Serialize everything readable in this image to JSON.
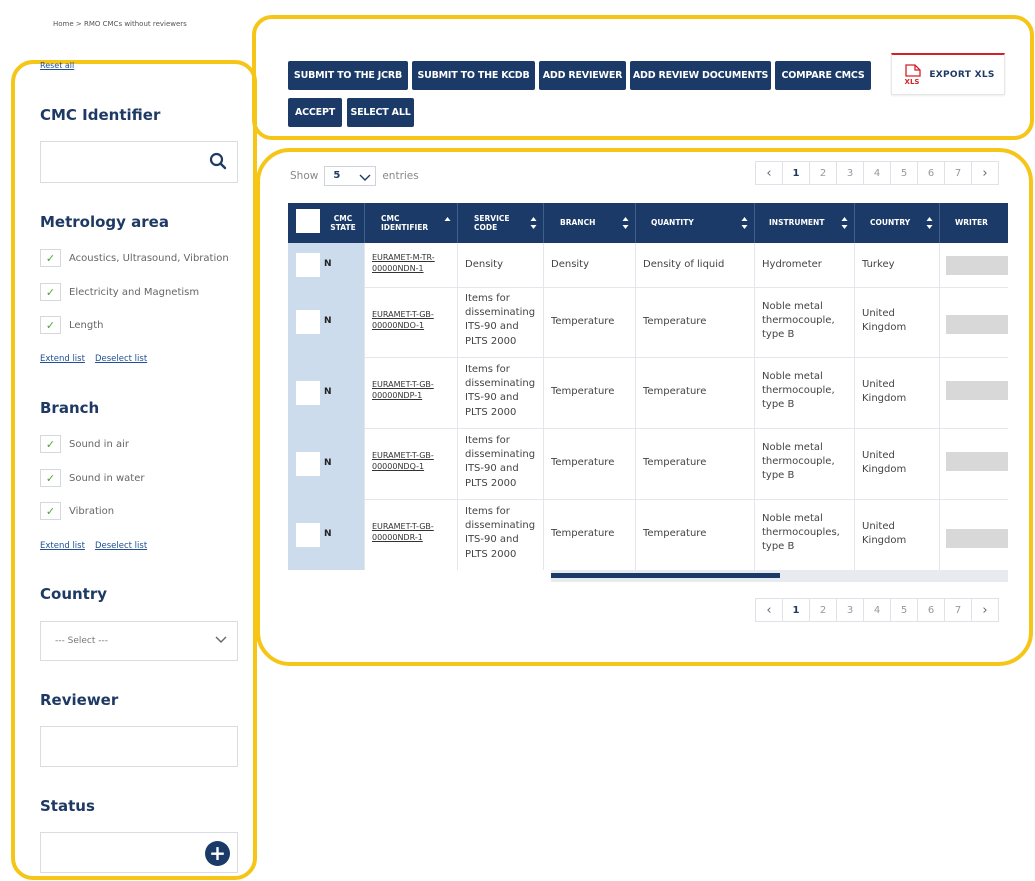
{
  "breadcrumb": "Home  > RMO CMCs without reviewers",
  "sidebar": {
    "reset_label": "Reset all",
    "cmc_identifier": {
      "title": "CMC Identifier",
      "value": "",
      "icon": "search-icon"
    },
    "metrology_area": {
      "title": "Metrology area",
      "items": [
        {
          "label": "Acoustics, Ultrasound, Vibration",
          "checked": true
        },
        {
          "label": "Electricity and Magnetism",
          "checked": true
        },
        {
          "label": "Length",
          "checked": true
        }
      ],
      "extend_label": "Extend list",
      "deselect_label": "Deselect list"
    },
    "branch": {
      "title": "Branch",
      "items": [
        {
          "label": "Sound in air",
          "checked": true
        },
        {
          "label": "Sound in water",
          "checked": true
        },
        {
          "label": "Vibration",
          "checked": true
        }
      ],
      "extend_label": "Extend list",
      "deselect_label": "Deselect list"
    },
    "country": {
      "title": "Country",
      "selected": "--- Select ---"
    },
    "reviewer": {
      "title": "Reviewer",
      "value": ""
    },
    "status": {
      "title": "Status",
      "value": "",
      "icon": "plus-icon"
    }
  },
  "toolbar": {
    "buttons": {
      "submit_jcrb": "SUBMIT TO THE JCRB",
      "submit_kcdb": "SUBMIT TO THE KCDB",
      "add_reviewer": "ADD REVIEWER",
      "add_review_documents": "ADD REVIEW DOCUMENTS",
      "compare_cmcs": "COMPARE CMCS",
      "accept": "ACCEPT",
      "select_all": "SELECT ALL"
    },
    "export_label": "EXPORT XLS",
    "export_badge": "XLS",
    "colors": {
      "button_bg": "#1b3a68",
      "export_accent": "#d42027",
      "highlight": "#f5c518"
    }
  },
  "table": {
    "show_label": "Show",
    "entries_label": "entries",
    "page_size": "5",
    "columns": {
      "cmc_state": "CMC STATE",
      "cmc_identifier": "CMC IDENTIFIER",
      "service_code": "SERVICE CODE",
      "branch": "BRANCH",
      "quantity": "QUANTITY",
      "instrument": "INSTRUMENT",
      "country": "COUNTRY",
      "writer": "WRITER"
    },
    "rows": [
      {
        "state": "N",
        "identifier": "EURAMET-M-TR-00000NDN-1",
        "service_code": "Density",
        "branch": "Density",
        "quantity": "Density of liquid",
        "instrument": "Hydrometer",
        "country": "Turkey",
        "writer": ""
      },
      {
        "state": "N",
        "identifier": "EURAMET-T-GB-00000NDO-1",
        "service_code": "Items for disseminating ITS-90 and PLTS 2000",
        "branch": "Temperature",
        "quantity": "Temperature",
        "instrument": "Noble metal thermocouple, type B",
        "country": "United Kingdom",
        "writer": ""
      },
      {
        "state": "N",
        "identifier": "EURAMET-T-GB-00000NDP-1",
        "service_code": "Items for disseminating ITS-90 and PLTS 2000",
        "branch": "Temperature",
        "quantity": "Temperature",
        "instrument": "Noble metal thermocouple, type B",
        "country": "United Kingdom",
        "writer": ""
      },
      {
        "state": "N",
        "identifier": "EURAMET-T-GB-00000NDQ-1",
        "service_code": "Items for disseminating ITS-90 and PLTS 2000",
        "branch": "Temperature",
        "quantity": "Temperature",
        "instrument": "Noble metal thermocouple, type B",
        "country": "United Kingdom",
        "writer": ""
      },
      {
        "state": "N",
        "identifier": "EURAMET-T-GB-00000NDR-1",
        "service_code": "Items for disseminating ITS-90 and PLTS 2000",
        "branch": "Temperature",
        "quantity": "Temperature",
        "instrument": "Noble metal thermocouples, type B",
        "country": "United Kingdom",
        "writer": ""
      }
    ],
    "horizontal_scroll_fraction": 0.5
  },
  "pagination": {
    "pages": [
      "1",
      "2",
      "3",
      "4",
      "5",
      "6",
      "7"
    ],
    "current": "1",
    "prev_icon": "chevron-left-icon",
    "next_icon": "chevron-right-icon"
  }
}
